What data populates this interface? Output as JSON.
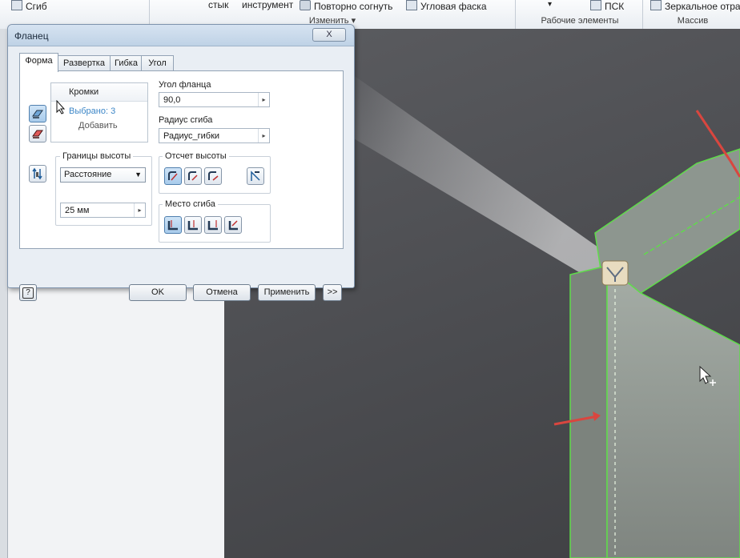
{
  "ribbon": {
    "items_top": [
      "Сгиб",
      "стык",
      "инструмент",
      "Повторно согнуть",
      "Угловая фаска",
      "ПСК",
      "Зеркальное отра"
    ],
    "groups": [
      "Изменить ▾",
      "Рабочие элементы",
      "Массив"
    ]
  },
  "dialog": {
    "title": "Фланец",
    "close_label": "X",
    "tabs": [
      "Форма",
      "Развертка",
      "Гибка",
      "Угол"
    ],
    "edges": {
      "header": "Кромки",
      "selected": "Выбрано: 3",
      "add": "Добавить"
    },
    "flange_angle": {
      "label": "Угол фланца",
      "value": "90,0"
    },
    "bend_radius": {
      "label": "Радиус сгиба",
      "value": "Радиус_гибки"
    },
    "height_extents": {
      "label": "Границы высоты",
      "option": "Расстояние",
      "value": "25 мм"
    },
    "height_datum": {
      "label": "Отсчет высоты"
    },
    "bend_position": {
      "label": "Место сгиба"
    },
    "buttons": {
      "ok": "OK",
      "cancel": "Отмена",
      "apply": "Применить",
      "more": ">>",
      "help": "?"
    }
  },
  "colors": {
    "highlight_edges": "#5fdc4a",
    "arrow": "#d9463f",
    "selected_text": "#3c86c7"
  }
}
